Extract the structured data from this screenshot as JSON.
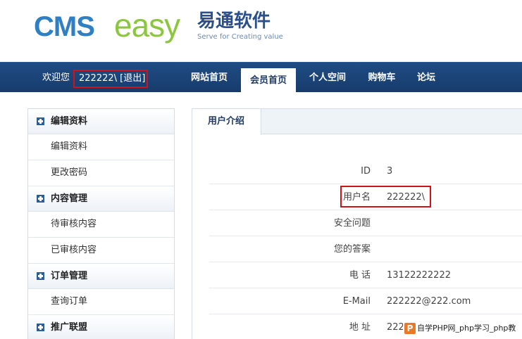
{
  "brand": {
    "logo_cms": "CMS",
    "logo_easy": "easy",
    "logo_cn": "易通软件",
    "slogan": "Serve for Creating value"
  },
  "nav": {
    "welcome": "欢迎您",
    "username_logout": "222222\\ [退出]",
    "items": [
      "网站首页",
      "会员首页",
      "个人空间",
      "购物车",
      "论坛"
    ],
    "active_index": 1
  },
  "sidebar": {
    "sections": [
      {
        "title": "编辑资料",
        "links": [
          "编辑资料",
          "更改密码"
        ]
      },
      {
        "title": "内容管理",
        "links": [
          "待审核内容",
          "已审核内容"
        ]
      },
      {
        "title": "订单管理",
        "links": [
          "查询订单"
        ]
      },
      {
        "title": "推广联盟",
        "links": []
      }
    ]
  },
  "main": {
    "tab": "用户介绍",
    "rows": [
      {
        "label": "ID",
        "value": "3"
      },
      {
        "label": "用户名",
        "value": "222222\\"
      },
      {
        "label": "安全问题",
        "value": ""
      },
      {
        "label": "您的答案",
        "value": ""
      },
      {
        "label": "电 话",
        "value": "13122222222"
      },
      {
        "label": "E-Mail",
        "value": "222222@222.com"
      },
      {
        "label": "地 址",
        "value": "222"
      }
    ]
  },
  "watermark": {
    "text": "自学PHP网_php学习_php教"
  },
  "colors": {
    "nav_bg": "#1f4c84",
    "highlight_border": "#d0121b",
    "logo_blue": "#2e7fc4",
    "logo_green": "#8cc63e"
  }
}
